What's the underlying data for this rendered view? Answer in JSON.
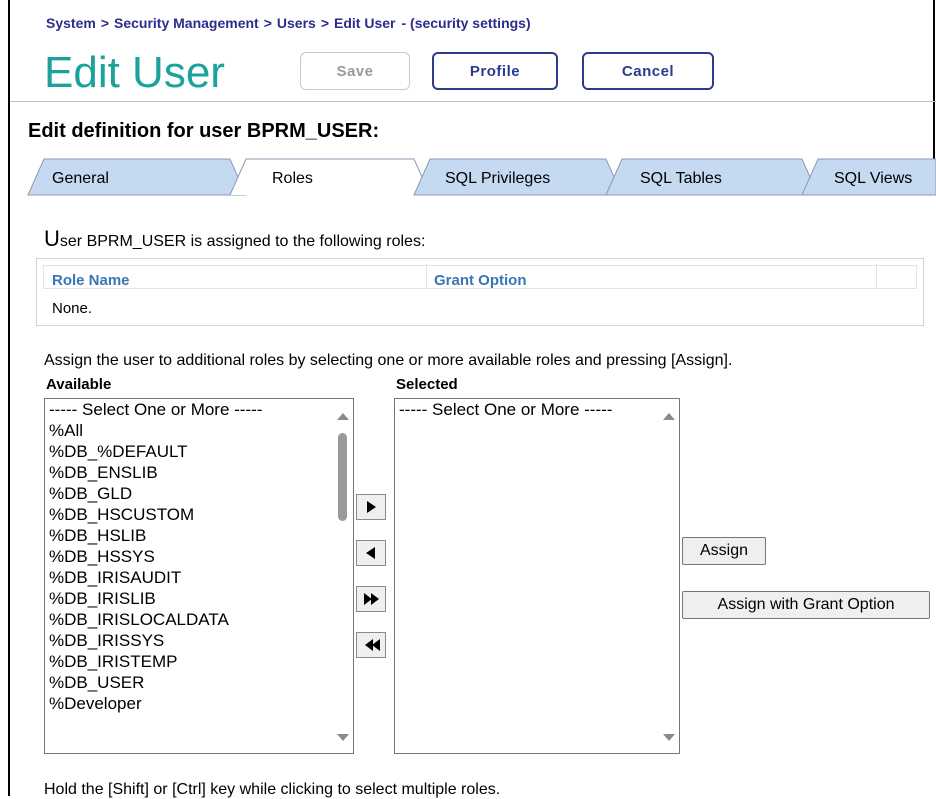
{
  "breadcrumb": {
    "items": [
      "System",
      "Security Management",
      "Users",
      "Edit User"
    ],
    "separator": ">",
    "suffix": "- (security settings)"
  },
  "page": {
    "title": "Edit User",
    "save_label": "Save",
    "profile_label": "Profile",
    "cancel_label": "Cancel",
    "section_title": "Edit definition for user BPRM_USER:"
  },
  "tabs": [
    {
      "label": "General",
      "active": false
    },
    {
      "label": "Roles",
      "active": true
    },
    {
      "label": "SQL Privileges",
      "active": false
    },
    {
      "label": "SQL Tables",
      "active": false
    },
    {
      "label": "SQL Views",
      "active": false
    }
  ],
  "roles": {
    "heading_initial": "U",
    "heading_rest": "ser BPRM_USER is assigned to the following roles:",
    "columns": {
      "role_name": "Role Name",
      "grant_option": "Grant Option"
    },
    "empty_text": "None."
  },
  "assign": {
    "instructions": "Assign the user to additional roles by selecting one or more available roles and pressing [Assign].",
    "available_label": "Available",
    "selected_label": "Selected",
    "available_items": [
      "----- Select One or More -----",
      "%All",
      "%DB_%DEFAULT",
      "%DB_ENSLIB",
      "%DB_GLD",
      "%DB_HSCUSTOM",
      "%DB_HSLIB",
      "%DB_HSSYS",
      "%DB_IRISAUDIT",
      "%DB_IRISLIB",
      "%DB_IRISLOCALDATA",
      "%DB_IRISSYS",
      "%DB_IRISTEMP",
      "%DB_USER",
      "%Developer"
    ],
    "selected_items": [
      "----- Select One or More -----"
    ],
    "assign_label": "Assign",
    "assign_grant_label": "Assign with Grant Option",
    "hint": "Hold the [Shift] or [Ctrl] key while clicking to select multiple roles."
  },
  "colors": {
    "title": "#1aa39a",
    "breadcrumb": "#2c2c8c",
    "button_border": "#2c3b8c",
    "column_header": "#3a75b8",
    "tab_fill": "#c5d9f1"
  }
}
